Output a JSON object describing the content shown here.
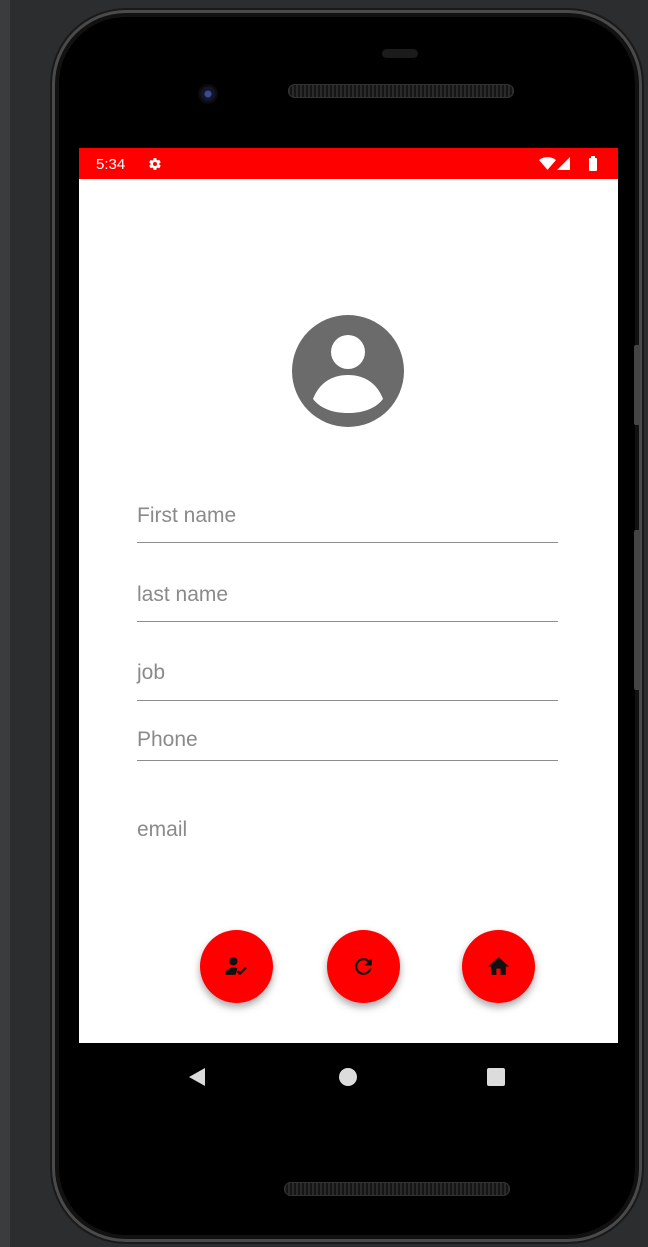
{
  "status_bar": {
    "time": "5:34",
    "background_color": "#ff0000",
    "icons": [
      "gear-icon",
      "wifi-icon",
      "signal-icon",
      "battery-icon"
    ]
  },
  "profile": {
    "avatar_icon": "account-circle-icon",
    "avatar_color": "#6b6b6b"
  },
  "form": {
    "first_name_placeholder": "First name",
    "last_name_placeholder": "last name",
    "job_placeholder": "job",
    "phone_placeholder": "Phone",
    "email_placeholder": "email"
  },
  "actions": {
    "accent_color": "#ff0000",
    "buttons": [
      "person-check-icon",
      "refresh-icon",
      "home-icon"
    ]
  },
  "nav_bar": {
    "buttons": [
      "back-icon",
      "home-icon",
      "recents-icon"
    ]
  }
}
